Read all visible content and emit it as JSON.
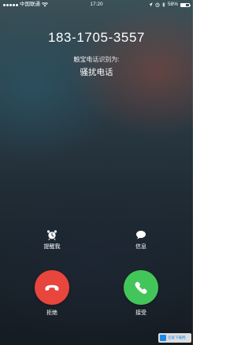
{
  "status_bar": {
    "carrier": "中国联通",
    "time": "17:20",
    "battery_text": "58%",
    "battery_level": 0.58
  },
  "call": {
    "phone_number": "183-1705-3557",
    "identified_by": "触宝电话识别为:",
    "tag": "骚扰电话"
  },
  "actions": {
    "remind_label": "提醒我",
    "message_label": "信息"
  },
  "buttons": {
    "decline_label": "拒绝",
    "accept_label": "接受"
  },
  "colors": {
    "decline": "#e8453c",
    "accept": "#43c659"
  },
  "watermark": {
    "text": "吾爱下载网"
  }
}
